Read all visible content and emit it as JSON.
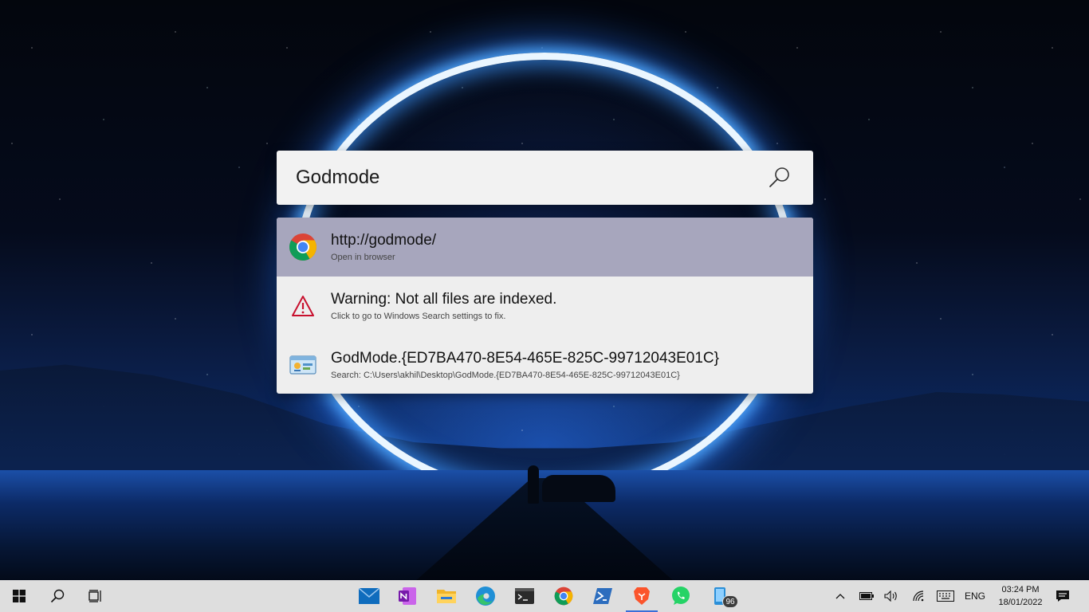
{
  "search": {
    "query": "Godmode",
    "icon": "search-icon"
  },
  "results": [
    {
      "title": "http://godmode/",
      "subtitle": "Open in browser",
      "icon": "chrome-icon",
      "selected": true
    },
    {
      "title": "Warning: Not all files are indexed.",
      "subtitle": "Click to go to Windows Search settings to fix.",
      "icon": "warning-icon",
      "selected": false
    },
    {
      "title": "GodMode.{ED7BA470-8E54-465E-825C-99712043E01C}",
      "subtitle": "Search: C:\\Users\\akhil\\Desktop\\GodMode.{ED7BA470-8E54-465E-825C-99712043E01C}",
      "icon": "control-panel-icon",
      "selected": false
    }
  ],
  "taskbar": {
    "left": [
      "windows-start-icon",
      "search-icon",
      "task-view-icon"
    ],
    "pinned": [
      "mail-icon",
      "onenote-icon",
      "file-explorer-icon",
      "edge-icon",
      "terminal-icon",
      "chrome-icon",
      "powershell-icon",
      "brave-icon",
      "whatsapp-icon",
      "phone-link-icon"
    ],
    "active_app": "brave-icon",
    "notification_badge": "96",
    "tray": {
      "language": "ENG",
      "time": "03:24 PM",
      "date": "18/01/2022"
    }
  },
  "colors": {
    "selected_row": "#a7a6bd",
    "taskbar": "#dedede",
    "warning": "#c8102e"
  }
}
